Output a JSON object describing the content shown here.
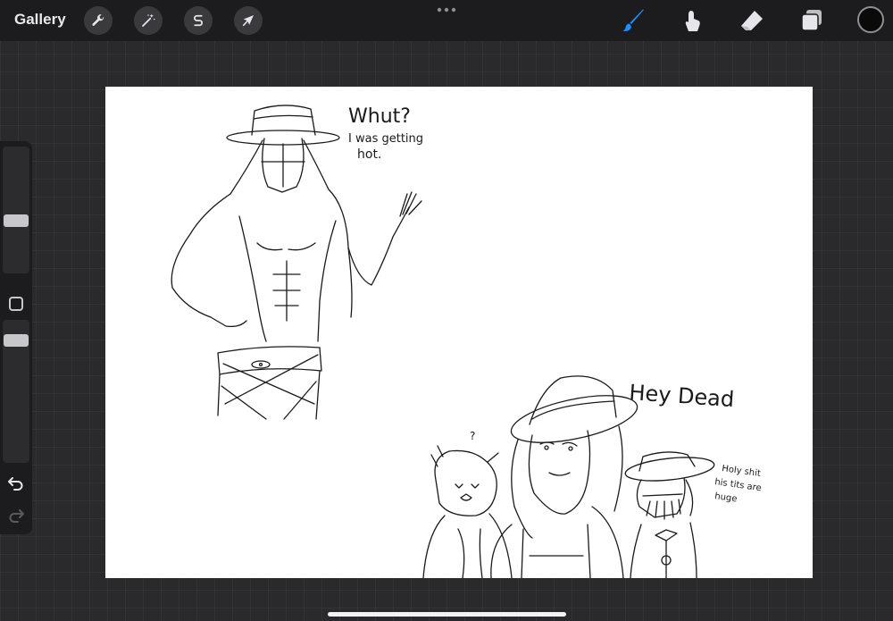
{
  "topbar": {
    "gallery_label": "Gallery",
    "left_tools": [
      {
        "name": "actions",
        "icon": "wrench-icon"
      },
      {
        "name": "adjustments",
        "icon": "magic-wand-icon"
      },
      {
        "name": "selection",
        "icon": "selection-s-icon"
      },
      {
        "name": "transform",
        "icon": "arrow-cursor-icon"
      }
    ],
    "right_tools": [
      {
        "name": "brush",
        "icon": "brush-icon",
        "active": true
      },
      {
        "name": "smudge",
        "icon": "smudge-icon",
        "active": false
      },
      {
        "name": "eraser",
        "icon": "eraser-icon",
        "active": false
      },
      {
        "name": "layers",
        "icon": "layers-icon",
        "active": false
      }
    ],
    "current_color": "#0a0a0a",
    "accent_color": "#1e90ff"
  },
  "sidebar": {
    "brush_size_level": 0.4,
    "opacity_level": 0.9
  },
  "canvas": {
    "texts": {
      "speech1_line1": "Whut?",
      "speech1_line2": "I was getting",
      "speech1_line3": "hot.",
      "speech2": "Hey Dead",
      "question_mark": "?",
      "speech3_line1": "Holy shit",
      "speech3_line2": "his tits are",
      "speech3_line3": "huge"
    }
  }
}
